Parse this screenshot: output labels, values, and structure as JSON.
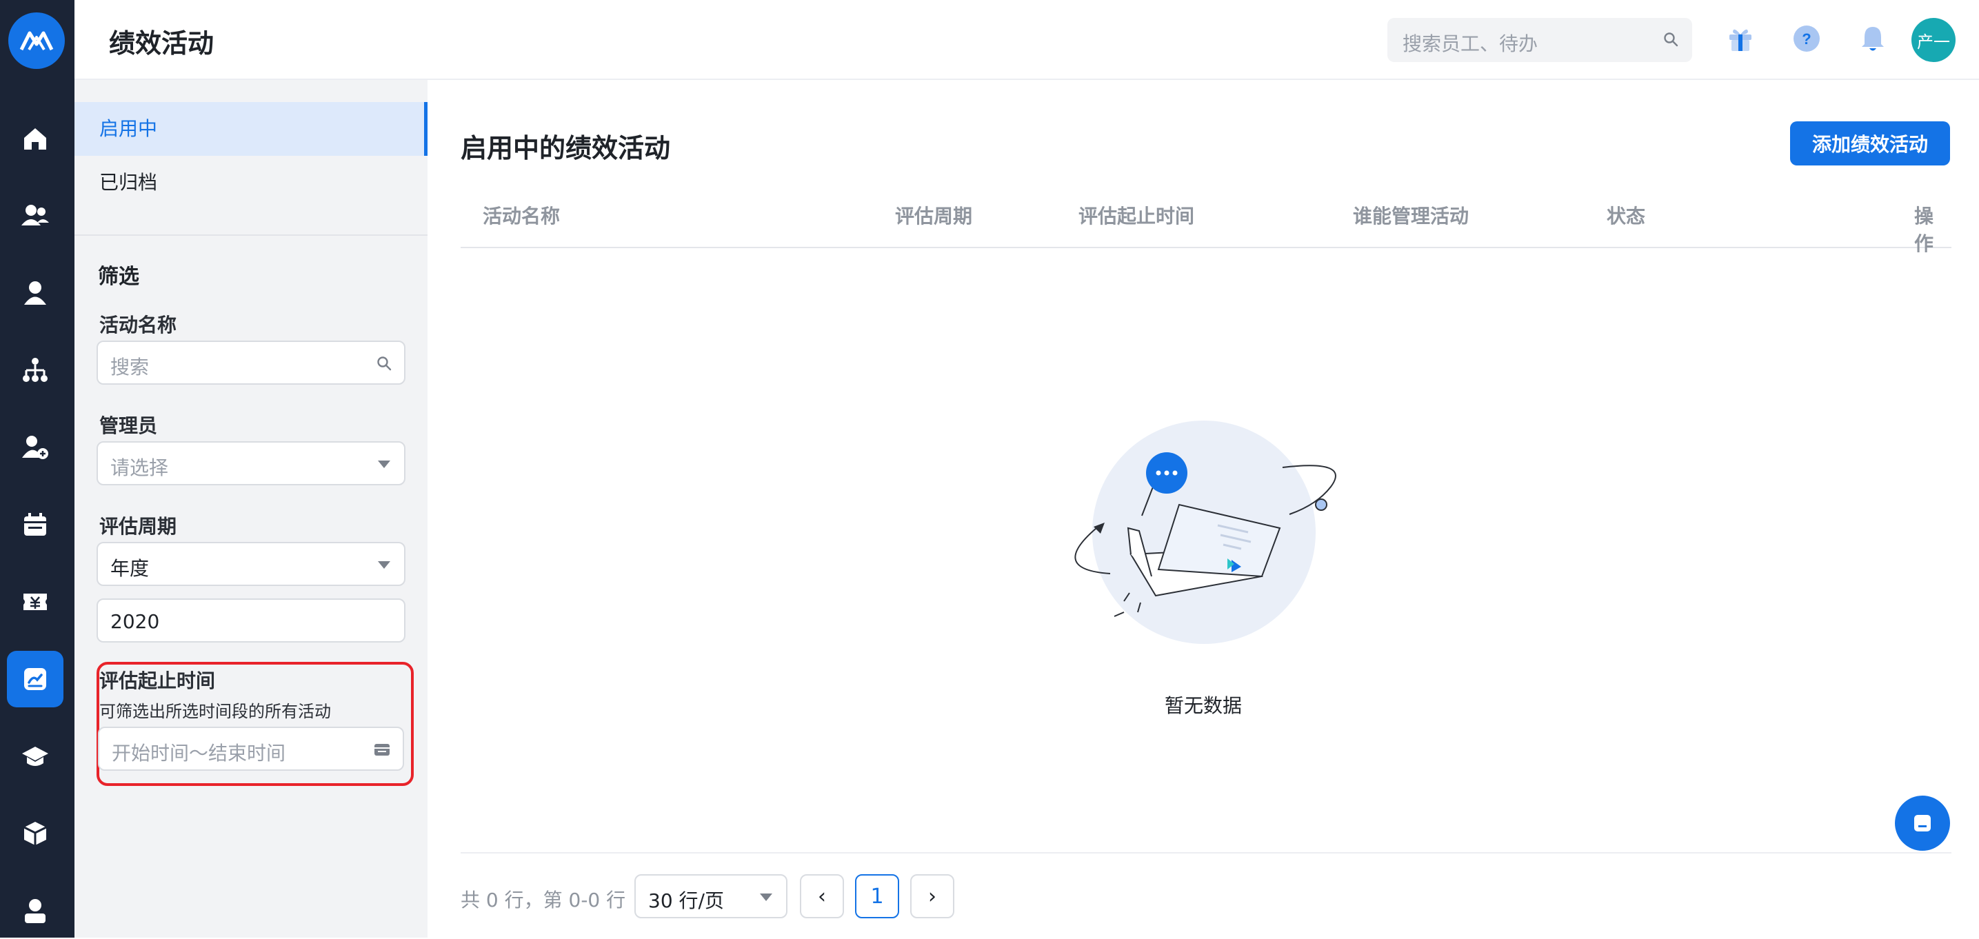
{
  "header": {
    "title": "绩效活动",
    "search_placeholder": "搜索员工、待办",
    "avatar_text": "产一",
    "icons": [
      "gift-icon",
      "help-icon",
      "bell-icon"
    ]
  },
  "rail": {
    "items": [
      "home-icon",
      "team-icon",
      "person-icon",
      "org-chart-icon",
      "add-person-icon",
      "calendar-icon",
      "payroll-icon",
      "performance-icon",
      "training-icon",
      "cube-icon",
      "profile-icon"
    ],
    "active": "performance-icon"
  },
  "sidebar": {
    "tabs": [
      {
        "label": "启用中",
        "active": true
      },
      {
        "label": "已归档",
        "active": false
      }
    ],
    "filter_heading": "筛选",
    "activity_name": {
      "label": "活动名称",
      "placeholder": "搜索"
    },
    "admin": {
      "label": "管理员",
      "placeholder": "请选择"
    },
    "cycle": {
      "label": "评估周期",
      "type_value": "年度",
      "year_value": "2020"
    },
    "date_range": {
      "label": "评估起止时间",
      "hint": "可筛选出所选时间段的所有活动",
      "placeholder": "开始时间～结束时间"
    }
  },
  "main": {
    "title": "启用中的绩效活动",
    "add_button": "添加绩效活动",
    "columns": [
      "活动名称",
      "评估周期",
      "评估起止时间",
      "谁能管理活动",
      "状态",
      "操作"
    ],
    "rows": [],
    "empty_text": "暂无数据"
  },
  "pagination": {
    "info": "共 0 行，第 0-0 行",
    "page_size": "30 行/页",
    "prev": "‹",
    "current_page": "1",
    "next": "›"
  },
  "colors": {
    "accent": "#1473e6",
    "rail_bg": "#1b2436",
    "sidebar_bg": "#f2f3f5",
    "highlight_border": "#e8232a",
    "avatar_bg": "#17a9b2"
  }
}
